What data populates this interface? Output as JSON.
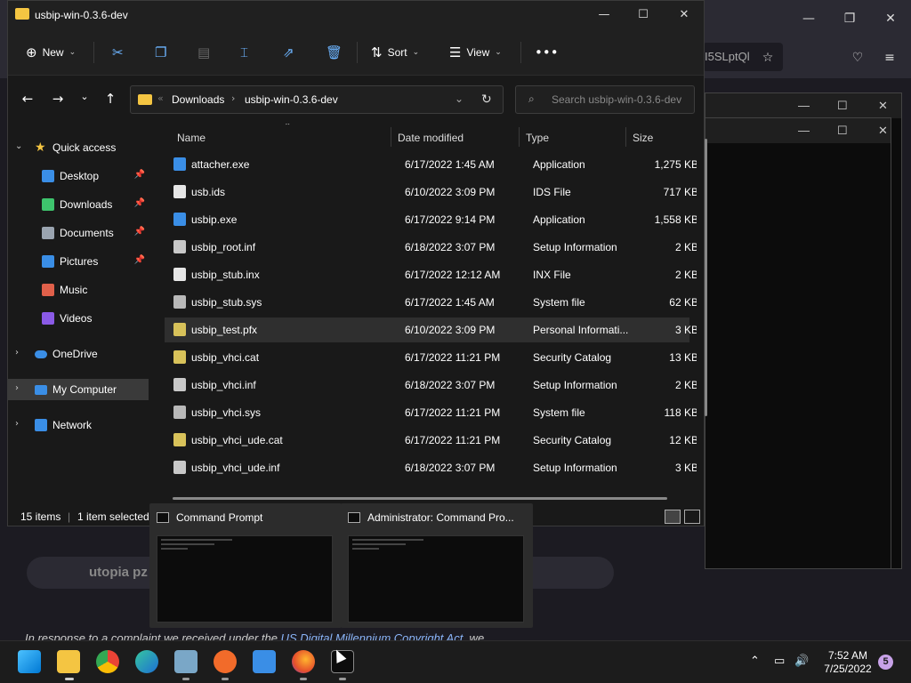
{
  "background": {
    "url_fragment": "I5SLptQl",
    "search_text": "utopia pz",
    "body_text_prefix": "In response to a complaint we received under the ",
    "body_link": "US Digital Millennium Copyright Act",
    "body_text_suffix": ", we"
  },
  "explorer": {
    "title": "usbip-win-0.3.6-dev",
    "toolbar": {
      "new_label": "New",
      "sort_label": "Sort",
      "view_label": "View"
    },
    "address": {
      "crumbs": [
        "Downloads",
        "usbip-win-0.3.6-dev"
      ]
    },
    "search": {
      "placeholder": "Search usbip-win-0.3.6-dev"
    },
    "nav": {
      "quick_access": "Quick access",
      "items": [
        {
          "label": "Desktop",
          "icon": "desktop-icon",
          "color": "#3a8ee6",
          "pinned": true
        },
        {
          "label": "Downloads",
          "icon": "download-icon",
          "color": "#3ec46d",
          "pinned": true
        },
        {
          "label": "Documents",
          "icon": "document-icon",
          "color": "#9aa4b0",
          "pinned": true
        },
        {
          "label": "Pictures",
          "icon": "pictures-icon",
          "color": "#3a8ee6",
          "pinned": true
        },
        {
          "label": "Music",
          "icon": "music-icon",
          "color": "#e0604a",
          "pinned": false
        },
        {
          "label": "Videos",
          "icon": "videos-icon",
          "color": "#8a5ae6",
          "pinned": false
        }
      ],
      "onedrive": "OneDrive",
      "mycomputer": "My Computer",
      "network": "Network"
    },
    "columns": {
      "name": "Name",
      "date": "Date modified",
      "type": "Type",
      "size": "Size"
    },
    "files": [
      {
        "name": "attacher.exe",
        "date": "6/17/2022 1:45 AM",
        "type": "Application",
        "size": "1,275 KB",
        "icon": "app",
        "selected": false
      },
      {
        "name": "usb.ids",
        "date": "6/10/2022 3:09 PM",
        "type": "IDS File",
        "size": "717 KB",
        "icon": "file",
        "selected": false
      },
      {
        "name": "usbip.exe",
        "date": "6/17/2022 9:14 PM",
        "type": "Application",
        "size": "1,558 KB",
        "icon": "app",
        "selected": false
      },
      {
        "name": "usbip_root.inf",
        "date": "6/18/2022 3:07 PM",
        "type": "Setup Information",
        "size": "2 KB",
        "icon": "inf",
        "selected": false
      },
      {
        "name": "usbip_stub.inx",
        "date": "6/17/2022 12:12 AM",
        "type": "INX File",
        "size": "2 KB",
        "icon": "file",
        "selected": false
      },
      {
        "name": "usbip_stub.sys",
        "date": "6/17/2022 1:45 AM",
        "type": "System file",
        "size": "62 KB",
        "icon": "sys",
        "selected": false
      },
      {
        "name": "usbip_test.pfx",
        "date": "6/10/2022 3:09 PM",
        "type": "Personal Informati...",
        "size": "3 KB",
        "icon": "cert",
        "selected": true
      },
      {
        "name": "usbip_vhci.cat",
        "date": "6/17/2022 11:21 PM",
        "type": "Security Catalog",
        "size": "13 KB",
        "icon": "cert",
        "selected": false
      },
      {
        "name": "usbip_vhci.inf",
        "date": "6/18/2022 3:07 PM",
        "type": "Setup Information",
        "size": "2 KB",
        "icon": "inf",
        "selected": false
      },
      {
        "name": "usbip_vhci.sys",
        "date": "6/17/2022 11:21 PM",
        "type": "System file",
        "size": "118 KB",
        "icon": "sys",
        "selected": false
      },
      {
        "name": "usbip_vhci_ude.cat",
        "date": "6/17/2022 11:21 PM",
        "type": "Security Catalog",
        "size": "12 KB",
        "icon": "cert",
        "selected": false
      },
      {
        "name": "usbip_vhci_ude.inf",
        "date": "6/18/2022 3:07 PM",
        "type": "Setup Information",
        "size": "3 KB",
        "icon": "inf",
        "selected": false
      }
    ],
    "status": {
      "count": "15 items",
      "selected": "1 item selected"
    }
  },
  "previews": [
    {
      "title": "Command Prompt"
    },
    {
      "title": "Administrator: Command Pro..."
    }
  ],
  "taskbar": {
    "icons": [
      "start-icon",
      "file-explorer-icon",
      "chrome-icon",
      "edge-icon",
      "remote-desktop-icon",
      "brave-icon",
      "store-icon",
      "firefox-icon",
      "terminal-icon"
    ],
    "time": "7:52 AM",
    "date": "7/25/2022",
    "notifications": "5"
  }
}
